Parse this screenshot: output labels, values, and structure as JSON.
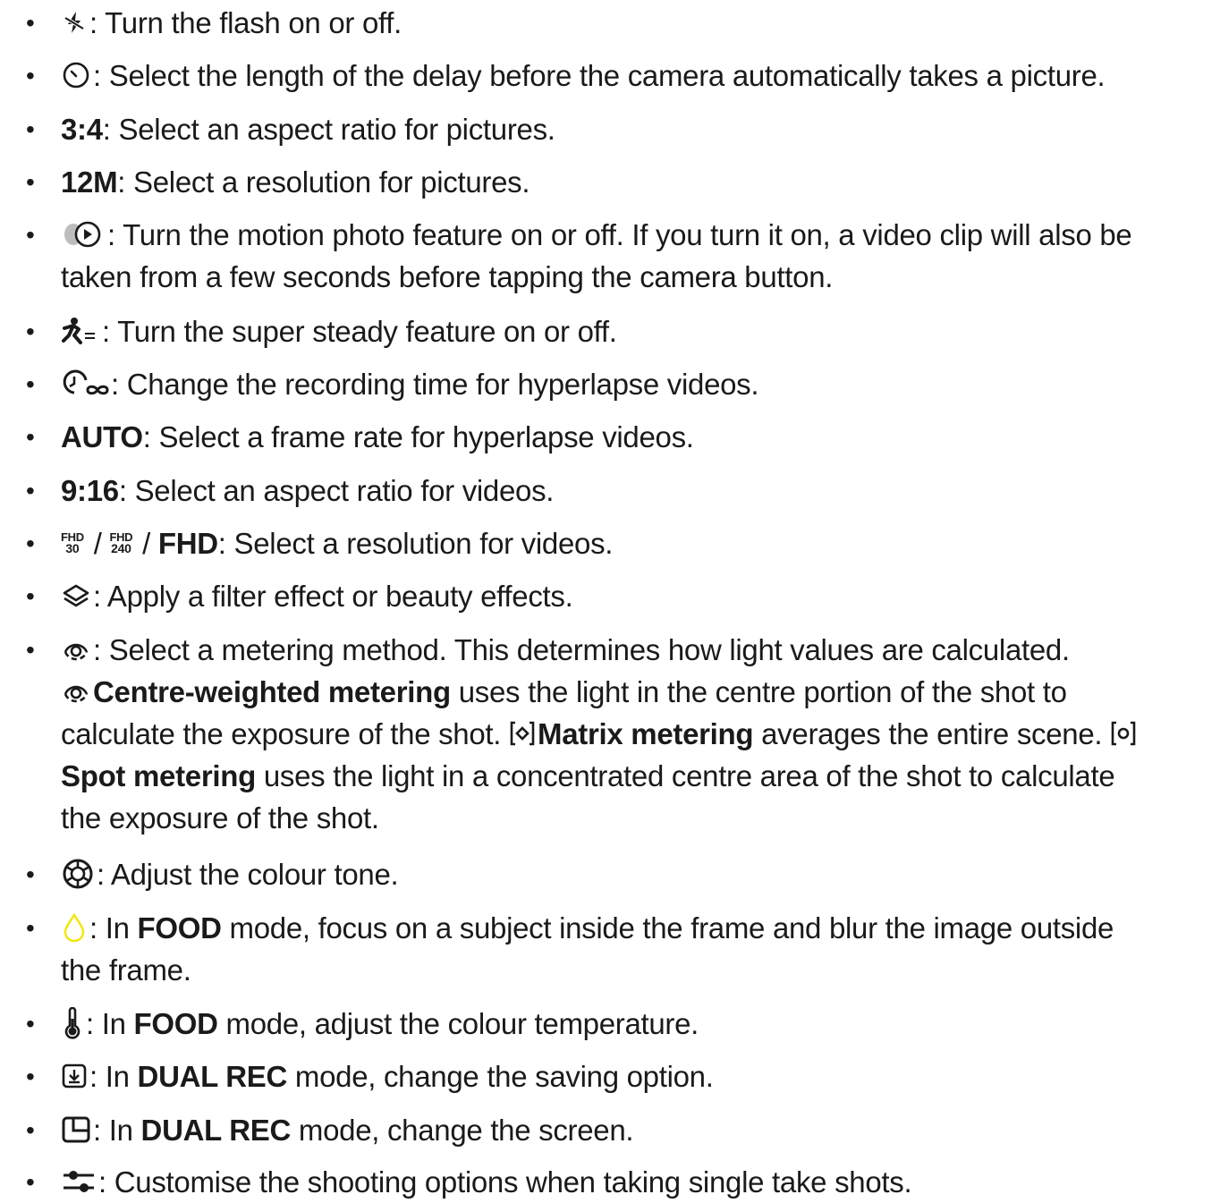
{
  "bullet_char": "•",
  "items": [
    {
      "icon": "flash-off-icon",
      "text": ": Turn the flash on or off."
    },
    {
      "icon": "timer-icon",
      "text": ": Select the length of the delay before the camera automatically takes a picture."
    },
    {
      "label": "3:4",
      "text": ": Select an aspect ratio for pictures."
    },
    {
      "label": "12M",
      "text": ": Select a resolution for pictures."
    },
    {
      "icon": "motion-photo-icon",
      "lines": [
        ": Turn the motion photo feature on or off. If you turn it on, a video clip will also be",
        "taken from a few seconds before tapping the camera button."
      ]
    },
    {
      "icon": "super-steady-icon",
      "text": ": Turn the super steady feature on or off."
    },
    {
      "icon": "hyperlapse-time-icon",
      "text": ": Change the recording time for hyperlapse videos."
    },
    {
      "label": "AUTO",
      "text": ": Select a frame rate for hyperlapse videos."
    },
    {
      "label": "9:16",
      "text": ": Select an aspect ratio for videos."
    },
    {
      "fhd_a_top": "FHD",
      "fhd_a_bottom": "30",
      "sep1": " / ",
      "fhd_b_top": "FHD",
      "fhd_b_bottom": "240",
      "sep2": " / ",
      "label": "FHD",
      "text": ": Select a resolution for videos."
    },
    {
      "icon": "filter-effects-icon",
      "text": ": Apply a filter effect or beauty effects."
    },
    {
      "icon": "metering-icon",
      "line1": ": Select a metering method. This determines how light values are calculated.",
      "centre_label": "Centre-weighted metering",
      "centre_text": " uses the light in the centre portion of the shot to",
      "line3_text": "calculate the exposure of the shot. ",
      "matrix_label": "Matrix metering",
      "matrix_text": " averages the entire scene. ",
      "spot_label": "Spot metering",
      "spot_text": " uses the light in a concentrated centre area of the shot to calculate",
      "line5": "the exposure of the shot."
    },
    {
      "icon": "colour-tone-icon",
      "text": ": Adjust the colour tone."
    },
    {
      "icon": "focus-blur-icon",
      "pre": ": In ",
      "mode": "FOOD",
      "post": " mode, focus on a subject inside the frame and blur the image outside",
      "line2": "the frame."
    },
    {
      "icon": "thermometer-icon",
      "pre": ": In ",
      "mode": "FOOD",
      "post": " mode, adjust the colour temperature."
    },
    {
      "icon": "save-option-icon",
      "pre": ": In ",
      "mode": "DUAL REC",
      "post": " mode, change the saving option."
    },
    {
      "icon": "screen-layout-icon",
      "pre": ": In ",
      "mode": "DUAL REC",
      "post": " mode, change the screen."
    },
    {
      "icon": "sliders-icon",
      "text": ": Customise the shooting options when taking single take shots."
    }
  ],
  "colors": {
    "text": "#1a1a1a",
    "focus_icon": "#f2e600"
  }
}
